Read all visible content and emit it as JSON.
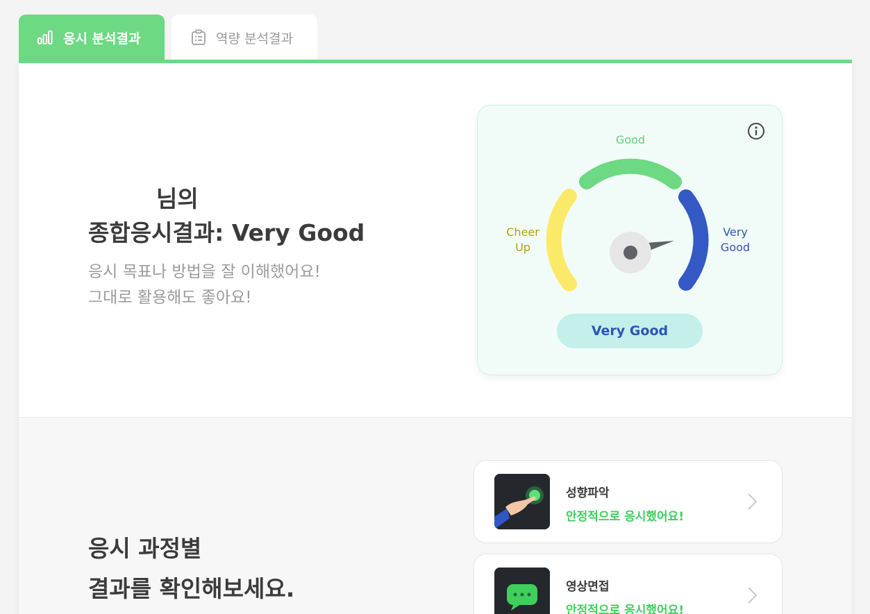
{
  "tabs": {
    "active": {
      "label": "응시 분석결과",
      "icon": "bar-chart-icon"
    },
    "inactive": {
      "label": "역량 분석결과",
      "icon": "clipboard-icon"
    }
  },
  "summary": {
    "name_suffix": "님의",
    "result_title": "종합응시결과: Very Good",
    "description": [
      "응시 목표나 방법을 잘 이해했어요!",
      "그대로 활용해도 좋아요!"
    ]
  },
  "gauge": {
    "labels": {
      "good": "Good",
      "cheer_up": [
        "Cheer",
        "Up"
      ],
      "very_good": [
        "Very",
        "Good"
      ]
    },
    "result": "Very Good",
    "level": "very-good",
    "colors": {
      "cheer_up": "#fbea6a",
      "good": "#6dd982",
      "very_good": "#3459c4",
      "needle": "#5f6368"
    },
    "info_icon": "info-icon"
  },
  "process": {
    "title": [
      "응시 과정별",
      "결과를 확인해보세요."
    ],
    "steps": [
      {
        "title": "성향파악",
        "status": "안정적으로 응시했어요!",
        "icon": "pointing-hand-icon"
      },
      {
        "title": "영상면접",
        "status": "안정적으로 응시했어요!",
        "icon": "chat-bubble-icon"
      }
    ]
  },
  "colors": {
    "accent": "#6dd982",
    "status_green": "#3fcf5d",
    "pill_bg": "#c4efeb",
    "pill_text": "#2b55b5"
  }
}
